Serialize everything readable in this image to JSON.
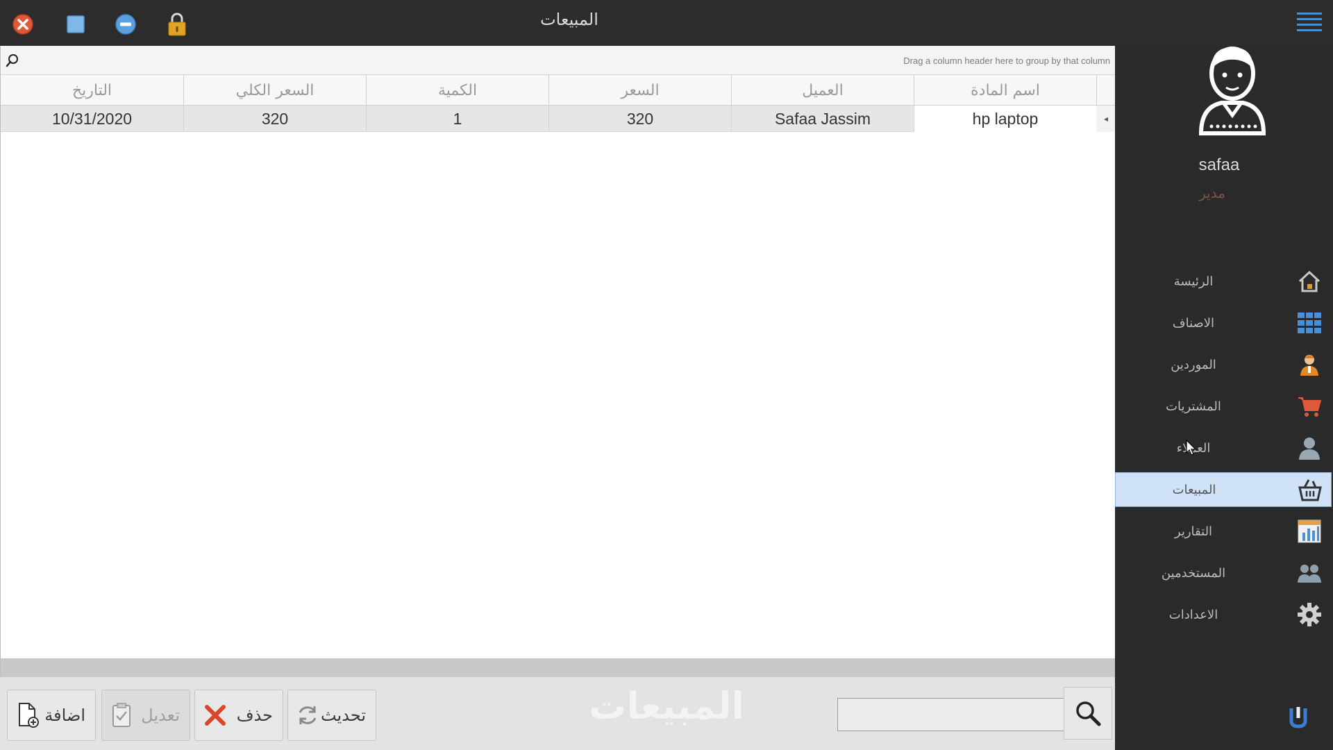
{
  "window": {
    "title": "المبيعات",
    "buttons": [
      "close-icon",
      "maximize-icon",
      "minimize-icon",
      "lock-icon"
    ]
  },
  "grid": {
    "group_hint": "Drag a column header here to group by that column",
    "columns": [
      "اسم المادة",
      "العميل",
      "السعر",
      "الكمية",
      "السعر الكلي",
      "التاريخ"
    ],
    "rows": [
      [
        "hp laptop",
        "Safaa Jassim",
        "320",
        "1",
        "320",
        "10/31/2020"
      ]
    ]
  },
  "actions": {
    "add_label": "اضافة",
    "edit_label": "تعديل",
    "delete_label": "حذف",
    "refresh_label": "تحديث",
    "watermark": "المبيعات",
    "search_value": ""
  },
  "sidebar": {
    "user_name": "safaa",
    "user_role": "مدير",
    "items": [
      {
        "label": "الرئيسة",
        "icon": "home-icon"
      },
      {
        "label": "الاصناف",
        "icon": "grid-icon"
      },
      {
        "label": "الموردين",
        "icon": "supplier-icon"
      },
      {
        "label": "المشتريات",
        "icon": "cart-icon"
      },
      {
        "label": "العملاء",
        "icon": "customer-icon"
      },
      {
        "label": "المبيعات",
        "icon": "sales-basket-icon",
        "active": true
      },
      {
        "label": "التقارير",
        "icon": "reports-icon"
      },
      {
        "label": "المستخدمين",
        "icon": "users-icon"
      },
      {
        "label": "الاعدادات",
        "icon": "gear-icon"
      }
    ]
  },
  "colors": {
    "accent_active": "#cfe2f7",
    "close_red": "#e0583a",
    "role_text": "#7f5248",
    "sidebar_bg": "#2a2a2a"
  }
}
